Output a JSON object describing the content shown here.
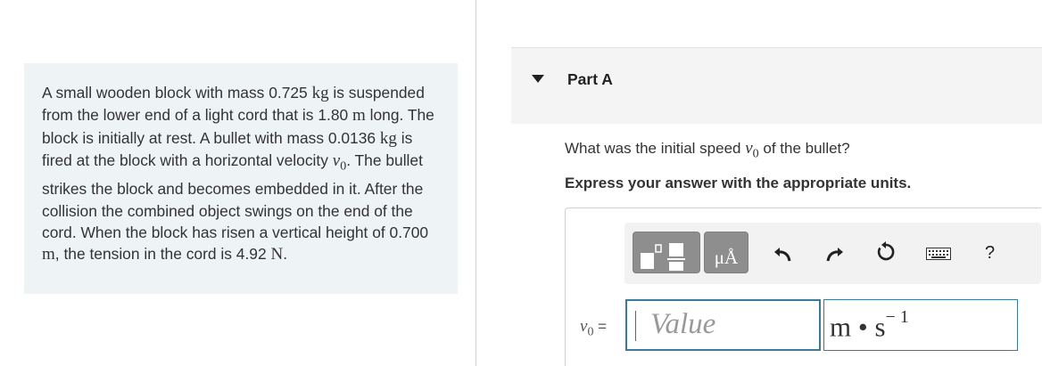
{
  "problem": {
    "t1": "A small wooden block with mass 0.725 ",
    "u1": "kg",
    "t2": " is suspended from the lower end of a light cord that is 1.80 ",
    "u2": "m",
    "t3": " long. The block is initially at rest. A bullet with mass 0.0136 ",
    "u3": "kg",
    "t4": " is fired at the block with a horizontal velocity ",
    "v1": "v",
    "s1": "0",
    "t5": ". The bullet strikes the block and becomes embedded in it. After the collision the combined object swings on the end of the cord. When the block has risen a vertical height of 0.700 ",
    "u4": "m",
    "t6": ", the tension in the cord is 4.92 ",
    "u5": "N",
    "t7": "."
  },
  "part": {
    "title": "Part A"
  },
  "question": {
    "q1": "What was the initial speed ",
    "v": "v",
    "s": "0",
    "q2": " of the bullet?",
    "instruction": "Express your answer with the appropriate units."
  },
  "toolbar": {
    "symbols_label": "μÅ",
    "help_label": "?",
    "icons": [
      "templates-icon",
      "symbols-icon",
      "undo-icon",
      "redo-icon",
      "reset-icon",
      "keyboard-icon",
      "help-icon"
    ]
  },
  "answer": {
    "label_var": "v",
    "label_sub": "0",
    "label_eq": " =",
    "value_placeholder": "Value",
    "units_main": "m • s",
    "units_exp": "− 1"
  },
  "colors": {
    "panel_bg": "#eef4f6",
    "input_border": "#3b7a9a",
    "toolbar_btn": "#8e8e8e"
  }
}
